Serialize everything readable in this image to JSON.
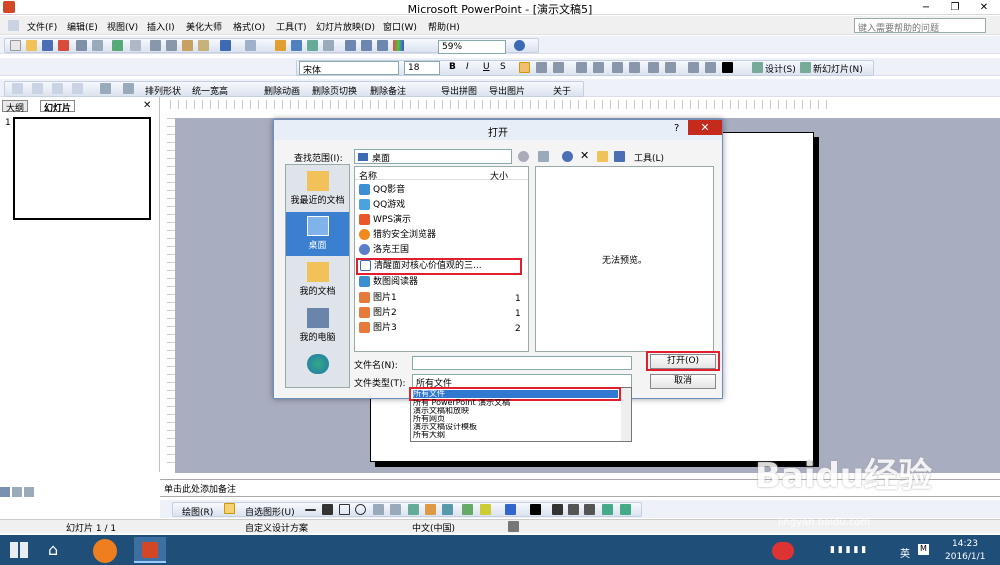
{
  "window": {
    "title": "Microsoft PowerPoint - [演示文稿5]",
    "min": "−",
    "max": "❐",
    "close": "✕"
  },
  "menu": [
    "文件(F)",
    "编辑(E)",
    "视图(V)",
    "插入(I)",
    "美化大师",
    "格式(O)",
    "工具(T)",
    "幻灯片放映(D)",
    "窗口(W)",
    "帮助(H)"
  ],
  "help_placeholder": "键入需要帮助的问题",
  "toolbar1": {
    "zoom": "59%"
  },
  "toolbar2": {
    "font": "宋体",
    "size": "18",
    "bold": "B",
    "italic": "I",
    "underline": "U",
    "shadow": "S",
    "design": "设计(S)",
    "new_slide": "新幻灯片(N)"
  },
  "toolbar3": {
    "items": [
      "排列形状",
      "统一宽高",
      "删除动画",
      "删除页切换",
      "删除备注",
      "导出拼图",
      "导出图片",
      "关于"
    ]
  },
  "leftpane": {
    "tabs": [
      "大纲",
      "幻灯片"
    ],
    "slide_num": "1"
  },
  "notes": "单击此处添加备注",
  "drawbar": {
    "draw": "绘图(R)",
    "autoshape": "自选图形(U)"
  },
  "status": {
    "slide": "幻灯片 1 / 1",
    "design": "自定义设计方案",
    "lang": "中文(中国)"
  },
  "taskbar": {
    "time": "14:23",
    "date": "2016/1/1",
    "ime": "英"
  },
  "dialog": {
    "title": "打开",
    "help": "?",
    "look_in_label": "查找范围(I):",
    "look_in_value": "桌面",
    "tools": "工具(L)",
    "places": [
      {
        "label": "我最近的文档"
      },
      {
        "label": "桌面"
      },
      {
        "label": "我的文档"
      },
      {
        "label": "我的电脑"
      },
      {
        "label": ""
      }
    ],
    "col_name": "名称",
    "col_size": "大小",
    "files": [
      {
        "name": "QQ影音",
        "size": ""
      },
      {
        "name": "QQ游戏",
        "size": ""
      },
      {
        "name": "WPS演示",
        "size": ""
      },
      {
        "name": "猎豹安全浏览器",
        "size": ""
      },
      {
        "name": "洛克王国",
        "size": ""
      },
      {
        "name": "清醒面对核心价值观的三...",
        "size": ""
      },
      {
        "name": "数图阅读器",
        "size": ""
      },
      {
        "name": "图片1",
        "size": "1"
      },
      {
        "name": "图片2",
        "size": "1"
      },
      {
        "name": "图片3",
        "size": "2"
      }
    ],
    "preview_text": "无法预览。",
    "filename_label": "文件名(N):",
    "filename_value": "",
    "filetype_label": "文件类型(T):",
    "filetype_value": "所有文件",
    "open_button": "打开(O)",
    "cancel_button": "取消",
    "filetype_options": [
      "所有文件",
      "所有 PowerPoint 演示文稿",
      "演示文稿和放映",
      "所有网页",
      "演示文稿设计模板",
      "所有大纲"
    ]
  },
  "watermark": "Baidu经验",
  "watermark_sub": "jingyan.baidu.com"
}
